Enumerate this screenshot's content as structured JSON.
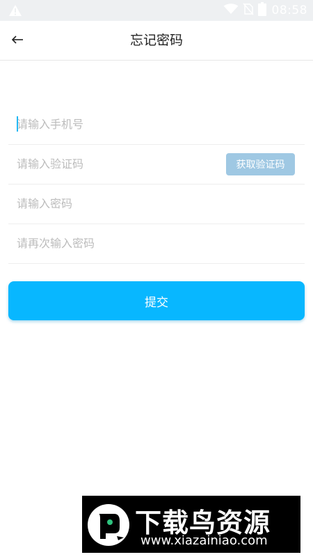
{
  "status_bar": {
    "time": "08:58",
    "icons": [
      "warning-icon",
      "wifi-icon",
      "no-sim-icon",
      "battery-icon"
    ]
  },
  "header": {
    "title": "忘记密码",
    "back_icon": "arrow-left-icon"
  },
  "form": {
    "phone_placeholder": "请输入手机号",
    "code_placeholder": "请输入验证码",
    "get_code_label": "获取验证码",
    "password_placeholder": "请输入密码",
    "confirm_placeholder": "请再次输入密码",
    "submit_label": "提交"
  },
  "watermark": {
    "brand": "下载鸟资源",
    "url": "www.xiazainiao.com"
  },
  "colors": {
    "accent": "#08b7ff",
    "code_button": "#9fc8e3",
    "status_bar": "#eef0f2"
  }
}
